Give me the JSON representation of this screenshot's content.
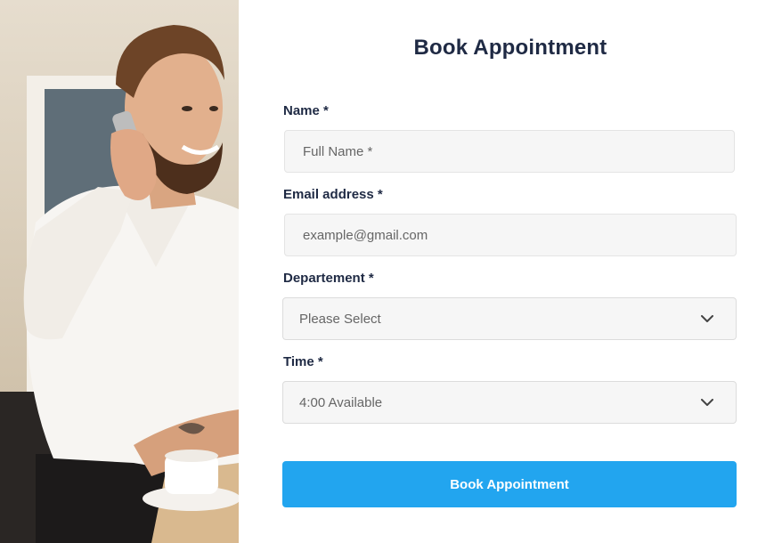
{
  "form": {
    "title": "Book Appointment",
    "name": {
      "label": "Name *",
      "placeholder": "Full Name *"
    },
    "email": {
      "label": "Email address *",
      "placeholder": "example@gmail.com"
    },
    "department": {
      "label": "Departement *",
      "selected": "Please Select"
    },
    "time": {
      "label": "Time *",
      "selected": "4:00 Available"
    },
    "submit_label": "Book Appointment"
  },
  "icons": {
    "dropdown": "chevron-down-icon"
  },
  "colors": {
    "accent": "#22a5ef",
    "heading": "#1f2a44",
    "field_bg": "#f6f6f6"
  }
}
